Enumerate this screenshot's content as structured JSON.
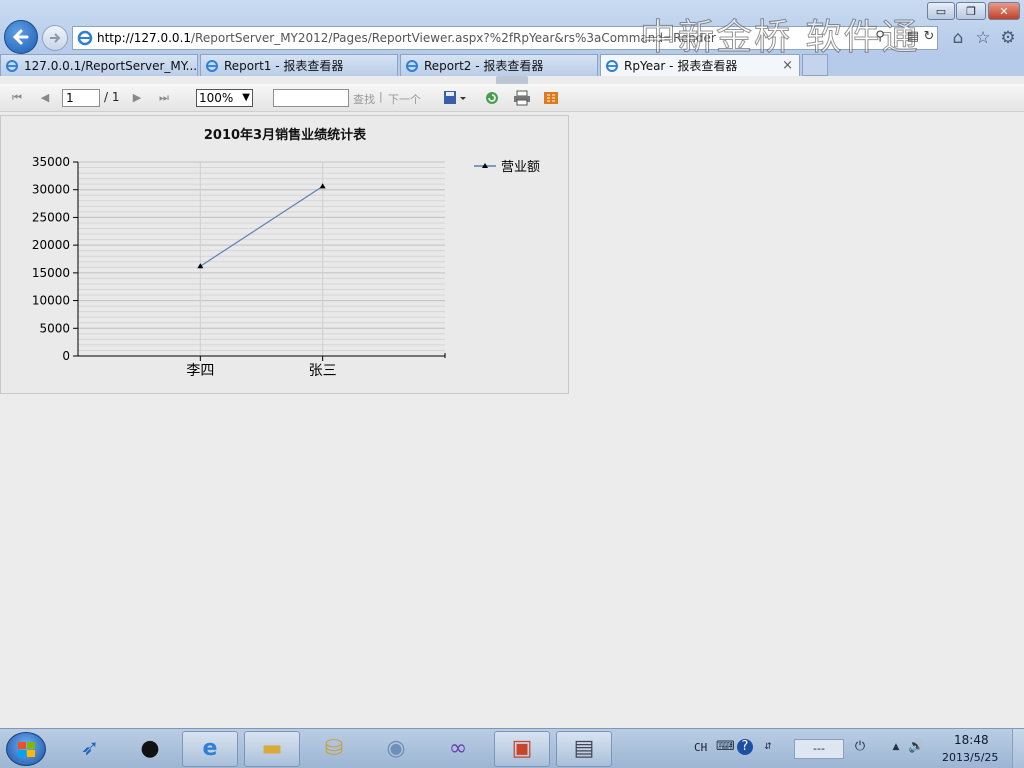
{
  "browser": {
    "url_host": "http://127.0.0.1",
    "url_path": "/ReportServer_MY2012/Pages/ReportViewer.aspx?%2fRpYear&rs%3aCommand=Render",
    "watermark": "中新金桥  软件通",
    "tabs": [
      {
        "label": "127.0.0.1/ReportServer_MY...",
        "active": false
      },
      {
        "label": "Report1 - 报表查看器",
        "active": false
      },
      {
        "label": "Report2 - 报表查看器",
        "active": false
      },
      {
        "label": "RpYear - 报表查看器",
        "active": true,
        "close": "×"
      }
    ]
  },
  "toolbar": {
    "page_value": "1",
    "page_total": "/ 1",
    "zoom_value": "100%",
    "find_placeholder": "",
    "find_label": "查找",
    "separator": "|",
    "next_label": "下一个"
  },
  "report": {
    "title": "2010年3月销售业绩统计表"
  },
  "chart_data": {
    "type": "line",
    "title": "2010年3月销售业绩统计表",
    "categories": [
      "李四",
      "张三"
    ],
    "series": [
      {
        "name": "营业额",
        "values": [
          16200,
          30600
        ],
        "color": "#5b7fb5"
      }
    ],
    "ylim": [
      0,
      35000
    ],
    "yticks": [
      0,
      5000,
      10000,
      15000,
      20000,
      25000,
      30000,
      35000
    ],
    "xlabel": "",
    "ylabel": "",
    "grid": true,
    "legend": "top-right"
  },
  "taskbar": {
    "tray_lang": "CH",
    "tray_box": "---",
    "time": "18:48",
    "date": "2013/5/25"
  },
  "colors": {
    "accent": "#1d5cb0",
    "line": "#5b7fb5",
    "background": "#ececec"
  }
}
